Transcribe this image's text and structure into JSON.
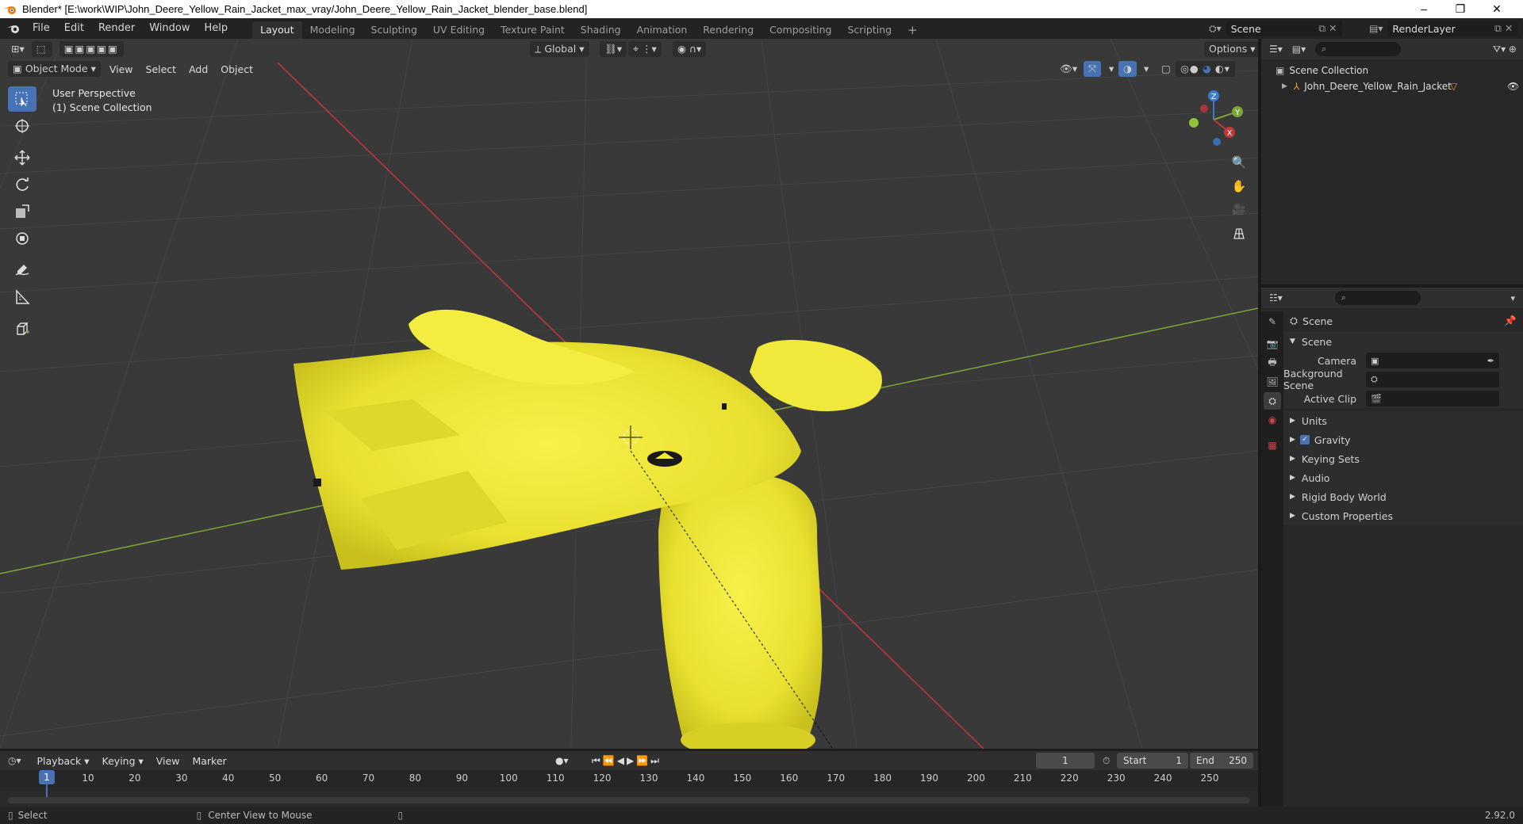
{
  "window": {
    "title": "Blender* [E:\\work\\WIP\\John_Deere_Yellow_Rain_Jacket_max_vray/John_Deere_Yellow_Rain_Jacket_blender_base.blend]",
    "minimize": "–",
    "maximize": "❐",
    "close": "✕"
  },
  "menu": {
    "file": "File",
    "edit": "Edit",
    "render": "Render",
    "window": "Window",
    "help": "Help"
  },
  "workspaces": [
    "Layout",
    "Modeling",
    "Sculpting",
    "UV Editing",
    "Texture Paint",
    "Shading",
    "Animation",
    "Rendering",
    "Compositing",
    "Scripting"
  ],
  "add_workspace": "+",
  "scene_field": "Scene",
  "renderlayer_field": "RenderLayer",
  "viewport": {
    "orientation": "Global",
    "options": "Options",
    "mode": "Object Mode",
    "menus": [
      "View",
      "Select",
      "Add",
      "Object"
    ],
    "overlay_line1": "User Perspective",
    "overlay_line2": "(1) Scene Collection",
    "gizmo": {
      "x": "X",
      "y": "Y",
      "z": "Z"
    }
  },
  "outliner": {
    "root": "Scene Collection",
    "item": "John_Deere_Yellow_Rain_Jacket"
  },
  "properties": {
    "context": "Scene",
    "panel_title": "Scene",
    "camera_label": "Camera",
    "background_scene_label": "Background Scene",
    "active_clip_label": "Active Clip",
    "panels": [
      "Units",
      "Gravity",
      "Keying Sets",
      "Audio",
      "Rigid Body World",
      "Custom Properties"
    ],
    "gravity_checked": true
  },
  "timeline": {
    "menus": [
      "Playback",
      "Keying",
      "View",
      "Marker"
    ],
    "current_frame": "1",
    "start_label": "Start",
    "start": "1",
    "end_label": "End",
    "end": "250",
    "ticks": [
      "1",
      "10",
      "20",
      "30",
      "40",
      "50",
      "60",
      "70",
      "80",
      "90",
      "100",
      "110",
      "120",
      "130",
      "140",
      "150",
      "160",
      "170",
      "180",
      "190",
      "200",
      "210",
      "220",
      "230",
      "240",
      "250"
    ]
  },
  "status": {
    "select": "Select",
    "center_view": "Center View to Mouse",
    "version": "2.92.0"
  },
  "colors": {
    "accent": "#4772b3",
    "jacket": "#f2ea3a",
    "axis_x": "#c3373a",
    "axis_y": "#7ba534",
    "axis_z": "#3a7bd6"
  }
}
